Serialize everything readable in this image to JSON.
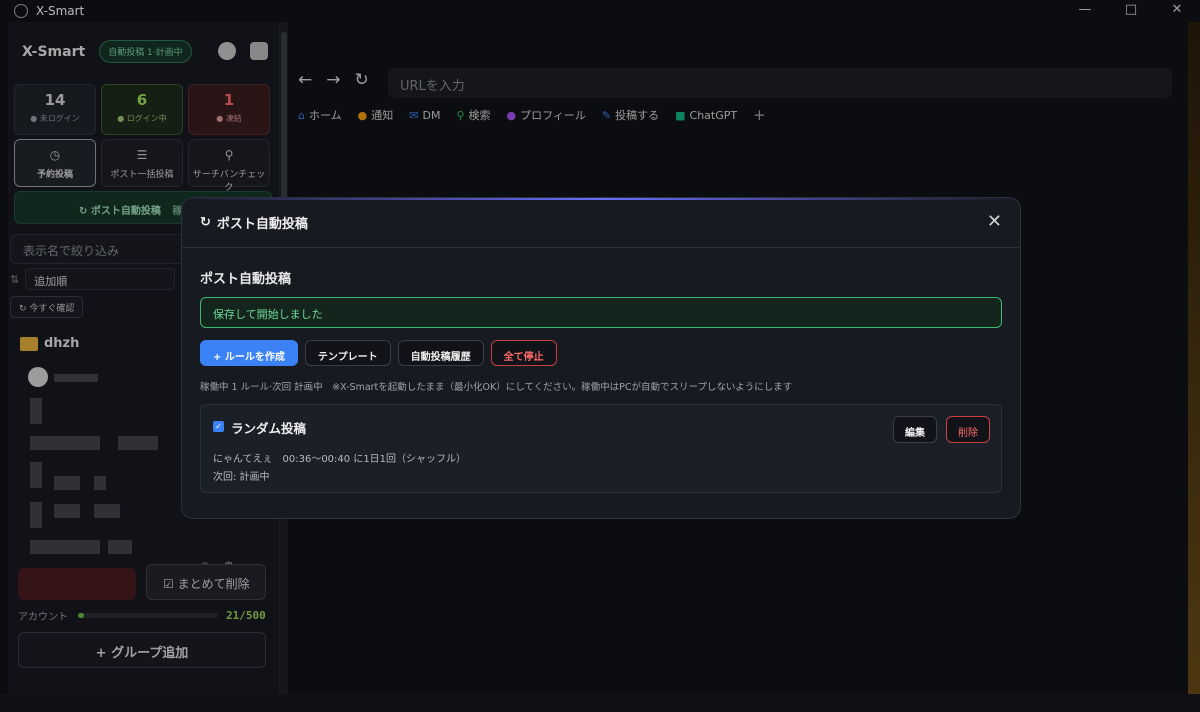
{
  "window": {
    "title": "X-Smart"
  },
  "sidebar": {
    "title": "X-Smart",
    "auto_badge": "自動投稿 1·計画中",
    "stats": [
      {
        "value": "14",
        "label": "未ログイン"
      },
      {
        "value": "6",
        "label": "ログイン中"
      },
      {
        "value": "1",
        "label": "凍結"
      }
    ],
    "tools": [
      {
        "label": "予約投稿",
        "icon": "clock-icon"
      },
      {
        "label": "ポスト一括投稿",
        "icon": "layers-icon"
      },
      {
        "label": "サーチバンチェック",
        "icon": "search-icon"
      }
    ],
    "autopost_button": "ポスト自動投稿",
    "autopost_badge_partial": "稼",
    "filter_placeholder": "表示名で絞り込み",
    "sort_value": "追加順",
    "check_now": "今すぐ確認",
    "group_name": "dhzh",
    "bulk_delete": "まとめて削除",
    "account_label": "アカウント",
    "account_count": "21/500",
    "add_group": "+ グループ追加"
  },
  "browser": {
    "url_placeholder": "URLを入力",
    "bookmarks": [
      {
        "label": "ホーム",
        "icon": "home-icon",
        "color": "#3b82f6"
      },
      {
        "label": "通知",
        "icon": "bell-icon",
        "color": "#f59e0b"
      },
      {
        "label": "DM",
        "icon": "mail-icon",
        "color": "#3b82f6"
      },
      {
        "label": "検索",
        "icon": "search-icon",
        "color": "#22c55e"
      },
      {
        "label": "プロフィール",
        "icon": "user-icon",
        "color": "#a855f7"
      },
      {
        "label": "投稿する",
        "icon": "feather-icon",
        "color": "#3b82f6"
      },
      {
        "label": "ChatGPT",
        "icon": "robot-icon",
        "color": "#10b981"
      }
    ]
  },
  "modal": {
    "title": "ポスト自動投稿",
    "section_title": "ポスト自動投稿",
    "success_message": "保存して開始しました",
    "buttons": {
      "create_rule": "+ ルールを作成",
      "template": "テンプレート",
      "history": "自動投稿履歴",
      "stop_all": "全て停止"
    },
    "status_line": "稼働中 1 ルール·次回 計画中　※X-Smartを起動したまま（最小化OK）にしてください。稼働中はPCが自動でスリープしないようにします",
    "rule": {
      "checked": true,
      "name": "ランダム投稿",
      "schedule": "にゃんてえぇ　00:36〜00:40 に1日1回（シャッフル）",
      "next": "次回: 計画中",
      "edit": "編集",
      "delete": "削除"
    }
  }
}
